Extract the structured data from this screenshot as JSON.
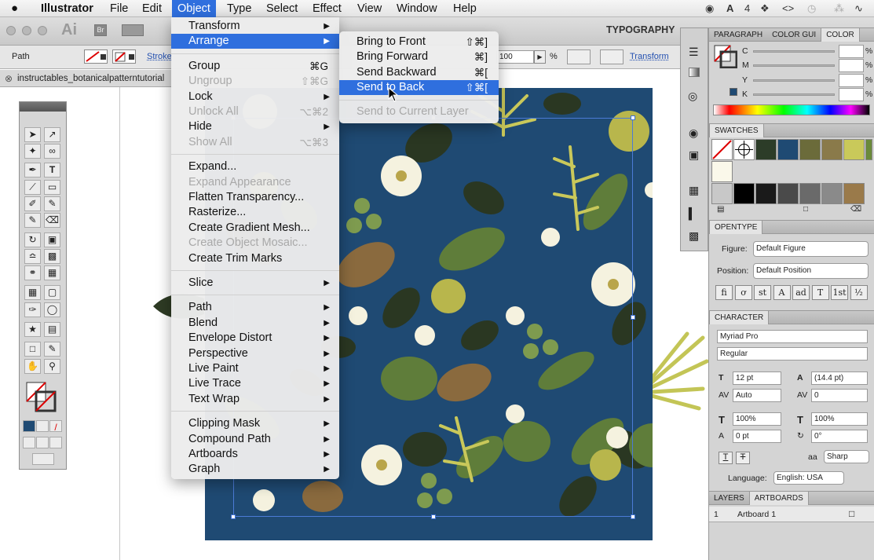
{
  "menubar": {
    "apple": "",
    "app": "Illustrator",
    "items": [
      "File",
      "Edit",
      "Object",
      "Type",
      "Select",
      "Effect",
      "View",
      "Window",
      "Help"
    ],
    "tray": {
      "ai_badge": "4"
    }
  },
  "appbar": {
    "logo": "Ai",
    "bridge": "Br",
    "workspace": "TYPOGRAPHY"
  },
  "control_bar": {
    "object_type": "Path",
    "stroke_label": "Stroke",
    "opacity_value": "100",
    "opacity_unit": "%",
    "transform_label": "Transform"
  },
  "doc_tab": {
    "close": "⊗",
    "title": "instructables_botanicalpatterntutorial"
  },
  "object_menu": {
    "items": [
      {
        "label": "Transform",
        "sub": true,
        "dis": false
      },
      {
        "label": "Arrange",
        "sub": true,
        "dis": false,
        "hl": true
      },
      {
        "label": "Group",
        "sc": "⌘G",
        "dis": false
      },
      {
        "label": "Ungroup",
        "sc": "⇧⌘G",
        "dis": true
      },
      {
        "label": "Lock",
        "sub": true,
        "dis": false
      },
      {
        "label": "Unlock All",
        "sc": "⌥⌘2",
        "dis": true
      },
      {
        "label": "Hide",
        "sub": true,
        "dis": false
      },
      {
        "label": "Show All",
        "sc": "⌥⌘3",
        "dis": true
      },
      {
        "label": "Expand...",
        "dis": false
      },
      {
        "label": "Expand Appearance",
        "dis": true
      },
      {
        "label": "Flatten Transparency...",
        "dis": false
      },
      {
        "label": "Rasterize...",
        "dis": false
      },
      {
        "label": "Create Gradient Mesh...",
        "dis": false
      },
      {
        "label": "Create Object Mosaic...",
        "dis": true
      },
      {
        "label": "Create Trim Marks",
        "dis": false
      },
      {
        "label": "Slice",
        "sub": true,
        "dis": false
      },
      {
        "label": "Path",
        "sub": true,
        "dis": false
      },
      {
        "label": "Blend",
        "sub": true,
        "dis": false
      },
      {
        "label": "Envelope Distort",
        "sub": true,
        "dis": false
      },
      {
        "label": "Perspective",
        "sub": true,
        "dis": false
      },
      {
        "label": "Live Paint",
        "sub": true,
        "dis": false
      },
      {
        "label": "Live Trace",
        "sub": true,
        "dis": false
      },
      {
        "label": "Text Wrap",
        "sub": true,
        "dis": false
      },
      {
        "label": "Clipping Mask",
        "sub": true,
        "dis": false
      },
      {
        "label": "Compound Path",
        "sub": true,
        "dis": false
      },
      {
        "label": "Artboards",
        "sub": true,
        "dis": false
      },
      {
        "label": "Graph",
        "sub": true,
        "dis": false
      }
    ]
  },
  "arrange_menu": {
    "items": [
      {
        "label": "Bring to Front",
        "sc": "⇧⌘]",
        "dis": false
      },
      {
        "label": "Bring Forward",
        "sc": "⌘]",
        "dis": false
      },
      {
        "label": "Send Backward",
        "sc": "⌘[",
        "dis": false
      },
      {
        "label": "Send to Back",
        "sc": "⇧⌘[",
        "dis": false,
        "hl": true
      },
      {
        "label": "Send to Current Layer",
        "dis": true
      }
    ]
  },
  "color_panel": {
    "tabs": [
      "PARAGRAPH",
      "COLOR GUI",
      "COLOR"
    ],
    "channels": [
      "C",
      "M",
      "Y",
      "K"
    ],
    "unit": "%"
  },
  "swatches": {
    "title": "SWATCHES",
    "colors": [
      "#2c3c28",
      "#1f4a73",
      "#6b6b3a",
      "#8a7a4a",
      "#c9c95a",
      "#6a8a3a",
      "#faf8ea",
      "#000000",
      "#1a1a1a",
      "#4a4a4a",
      "#6a6a6a",
      "#8a8a8a",
      "#9a7a4a"
    ]
  },
  "opentype": {
    "title": "OPENTYPE",
    "figure_label": "Figure:",
    "figure_value": "Default Figure",
    "position_label": "Position:",
    "position_value": "Default Position",
    "glyphs": [
      "fi",
      "ơ",
      "st",
      "A",
      "ad",
      "T",
      "1st",
      "½"
    ]
  },
  "character": {
    "title": "CHARACTER",
    "font": "Myriad Pro",
    "style": "Regular",
    "size": "12 pt",
    "leading": "(14.4 pt)",
    "kerning": "Auto",
    "tracking": "0",
    "vscale": "100%",
    "hscale": "100%",
    "baseline": "0 pt",
    "rotation": "0°",
    "aa_label": "aa",
    "aa": "Sharp",
    "language_label": "Language:",
    "language": "English: USA"
  },
  "layers": {
    "tabs": [
      "LAYERS",
      "ARTBOARDS"
    ],
    "row_num": "1",
    "row_name": "Artboard 1"
  },
  "colors": {
    "accent": "#2f6fde",
    "artboard_bg": "#1f4a73"
  }
}
